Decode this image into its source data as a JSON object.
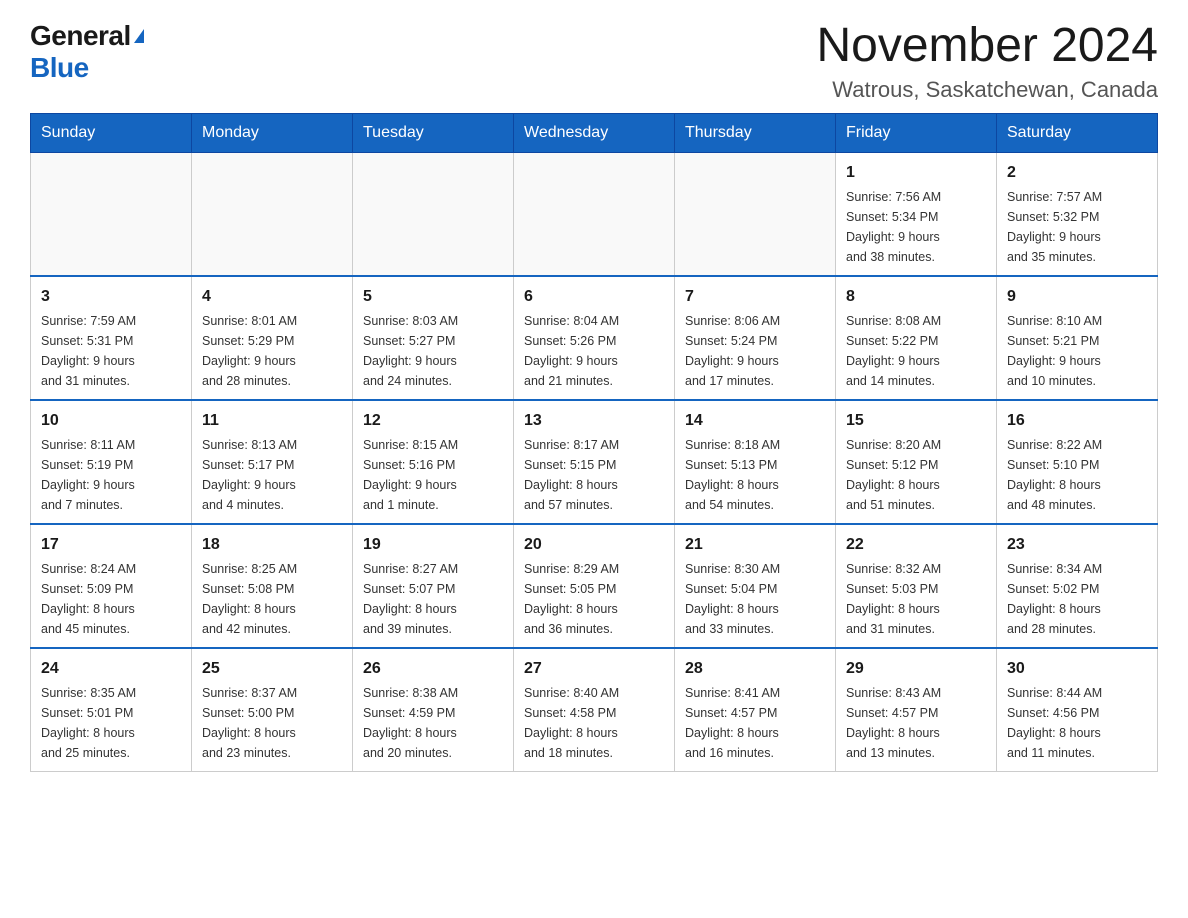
{
  "header": {
    "logo_general": "General",
    "logo_blue": "Blue",
    "month_title": "November 2024",
    "location": "Watrous, Saskatchewan, Canada"
  },
  "weekdays": [
    "Sunday",
    "Monday",
    "Tuesday",
    "Wednesday",
    "Thursday",
    "Friday",
    "Saturday"
  ],
  "weeks": [
    [
      {
        "day": "",
        "info": ""
      },
      {
        "day": "",
        "info": ""
      },
      {
        "day": "",
        "info": ""
      },
      {
        "day": "",
        "info": ""
      },
      {
        "day": "",
        "info": ""
      },
      {
        "day": "1",
        "info": "Sunrise: 7:56 AM\nSunset: 5:34 PM\nDaylight: 9 hours\nand 38 minutes."
      },
      {
        "day": "2",
        "info": "Sunrise: 7:57 AM\nSunset: 5:32 PM\nDaylight: 9 hours\nand 35 minutes."
      }
    ],
    [
      {
        "day": "3",
        "info": "Sunrise: 7:59 AM\nSunset: 5:31 PM\nDaylight: 9 hours\nand 31 minutes."
      },
      {
        "day": "4",
        "info": "Sunrise: 8:01 AM\nSunset: 5:29 PM\nDaylight: 9 hours\nand 28 minutes."
      },
      {
        "day": "5",
        "info": "Sunrise: 8:03 AM\nSunset: 5:27 PM\nDaylight: 9 hours\nand 24 minutes."
      },
      {
        "day": "6",
        "info": "Sunrise: 8:04 AM\nSunset: 5:26 PM\nDaylight: 9 hours\nand 21 minutes."
      },
      {
        "day": "7",
        "info": "Sunrise: 8:06 AM\nSunset: 5:24 PM\nDaylight: 9 hours\nand 17 minutes."
      },
      {
        "day": "8",
        "info": "Sunrise: 8:08 AM\nSunset: 5:22 PM\nDaylight: 9 hours\nand 14 minutes."
      },
      {
        "day": "9",
        "info": "Sunrise: 8:10 AM\nSunset: 5:21 PM\nDaylight: 9 hours\nand 10 minutes."
      }
    ],
    [
      {
        "day": "10",
        "info": "Sunrise: 8:11 AM\nSunset: 5:19 PM\nDaylight: 9 hours\nand 7 minutes."
      },
      {
        "day": "11",
        "info": "Sunrise: 8:13 AM\nSunset: 5:17 PM\nDaylight: 9 hours\nand 4 minutes."
      },
      {
        "day": "12",
        "info": "Sunrise: 8:15 AM\nSunset: 5:16 PM\nDaylight: 9 hours\nand 1 minute."
      },
      {
        "day": "13",
        "info": "Sunrise: 8:17 AM\nSunset: 5:15 PM\nDaylight: 8 hours\nand 57 minutes."
      },
      {
        "day": "14",
        "info": "Sunrise: 8:18 AM\nSunset: 5:13 PM\nDaylight: 8 hours\nand 54 minutes."
      },
      {
        "day": "15",
        "info": "Sunrise: 8:20 AM\nSunset: 5:12 PM\nDaylight: 8 hours\nand 51 minutes."
      },
      {
        "day": "16",
        "info": "Sunrise: 8:22 AM\nSunset: 5:10 PM\nDaylight: 8 hours\nand 48 minutes."
      }
    ],
    [
      {
        "day": "17",
        "info": "Sunrise: 8:24 AM\nSunset: 5:09 PM\nDaylight: 8 hours\nand 45 minutes."
      },
      {
        "day": "18",
        "info": "Sunrise: 8:25 AM\nSunset: 5:08 PM\nDaylight: 8 hours\nand 42 minutes."
      },
      {
        "day": "19",
        "info": "Sunrise: 8:27 AM\nSunset: 5:07 PM\nDaylight: 8 hours\nand 39 minutes."
      },
      {
        "day": "20",
        "info": "Sunrise: 8:29 AM\nSunset: 5:05 PM\nDaylight: 8 hours\nand 36 minutes."
      },
      {
        "day": "21",
        "info": "Sunrise: 8:30 AM\nSunset: 5:04 PM\nDaylight: 8 hours\nand 33 minutes."
      },
      {
        "day": "22",
        "info": "Sunrise: 8:32 AM\nSunset: 5:03 PM\nDaylight: 8 hours\nand 31 minutes."
      },
      {
        "day": "23",
        "info": "Sunrise: 8:34 AM\nSunset: 5:02 PM\nDaylight: 8 hours\nand 28 minutes."
      }
    ],
    [
      {
        "day": "24",
        "info": "Sunrise: 8:35 AM\nSunset: 5:01 PM\nDaylight: 8 hours\nand 25 minutes."
      },
      {
        "day": "25",
        "info": "Sunrise: 8:37 AM\nSunset: 5:00 PM\nDaylight: 8 hours\nand 23 minutes."
      },
      {
        "day": "26",
        "info": "Sunrise: 8:38 AM\nSunset: 4:59 PM\nDaylight: 8 hours\nand 20 minutes."
      },
      {
        "day": "27",
        "info": "Sunrise: 8:40 AM\nSunset: 4:58 PM\nDaylight: 8 hours\nand 18 minutes."
      },
      {
        "day": "28",
        "info": "Sunrise: 8:41 AM\nSunset: 4:57 PM\nDaylight: 8 hours\nand 16 minutes."
      },
      {
        "day": "29",
        "info": "Sunrise: 8:43 AM\nSunset: 4:57 PM\nDaylight: 8 hours\nand 13 minutes."
      },
      {
        "day": "30",
        "info": "Sunrise: 8:44 AM\nSunset: 4:56 PM\nDaylight: 8 hours\nand 11 minutes."
      }
    ]
  ]
}
